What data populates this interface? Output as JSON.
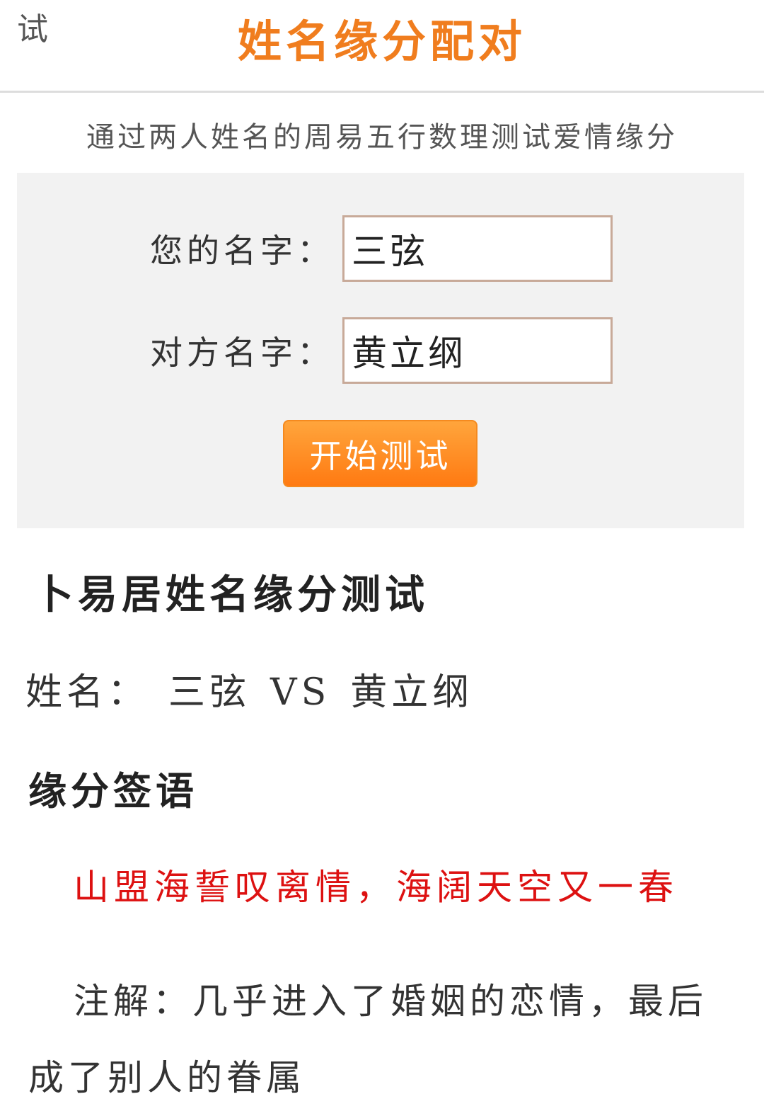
{
  "header": {
    "back_glyph": "试",
    "title": "姓名缘分配对"
  },
  "subtitle": "通过两人姓名的周易五行数理测试爱情缘分",
  "form": {
    "your_name_label": "您的名字：",
    "your_name_value": "三弦",
    "partner_name_label": "对方名字：",
    "partner_name_value": "黄立纲",
    "submit_label": "开始测试"
  },
  "result": {
    "heading": "卜易居姓名缘分测试",
    "names_prefix": "姓名：",
    "name_a": "三弦",
    "vs": "VS",
    "name_b": "黄立纲",
    "section_heading": "缘分签语",
    "verse": "山盟海誓叹离情，海阔天空又一春",
    "annotation": "注解：几乎进入了婚姻的恋情，最后成了别人的眷属"
  },
  "colors": {
    "title": "#f07d1e",
    "button": "#ff8c1a",
    "verse": "#dd1111",
    "panel": "#f2f2f2",
    "input_border": "#c8aa99"
  }
}
